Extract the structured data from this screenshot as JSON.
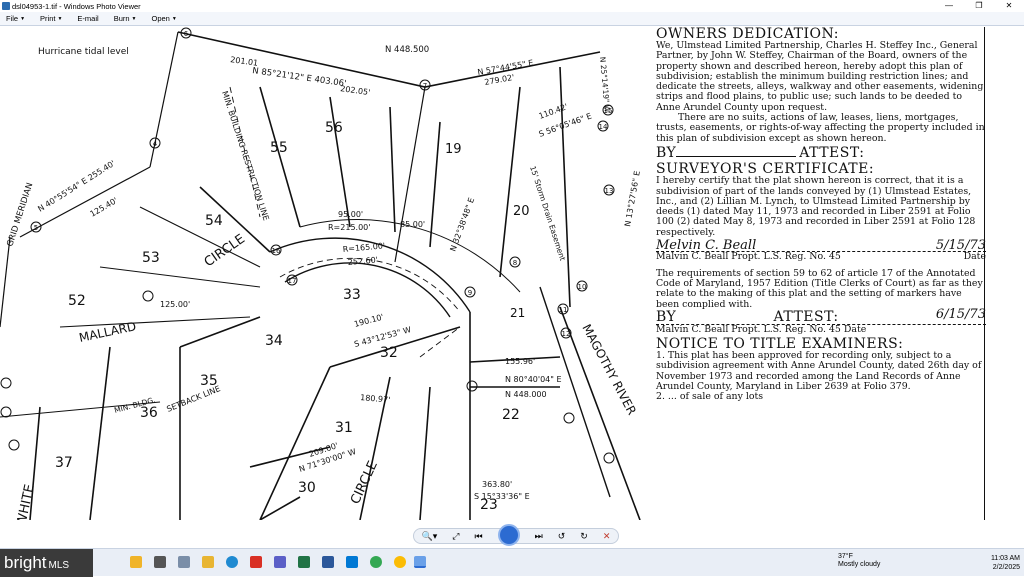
{
  "window": {
    "title": "dsl04953-1.tif - Windows Photo Viewer",
    "buttons": [
      "—",
      "❐",
      "✕"
    ]
  },
  "menu": {
    "items": [
      {
        "label": "File"
      },
      {
        "label": "Print"
      },
      {
        "label": "E-mail"
      },
      {
        "label": "Burn"
      },
      {
        "label": "Open"
      }
    ]
  },
  "plat": {
    "lots": [
      "56",
      "55",
      "54",
      "53",
      "52",
      "33",
      "34",
      "35",
      "36",
      "37",
      "32",
      "31",
      "30",
      "21",
      "22",
      "23",
      "20",
      "19"
    ],
    "streets": [
      "CIRCLE",
      "MALLARD",
      "CIRCLE",
      "WHITE",
      "MAGOTHY RIVER"
    ],
    "labels": {
      "hurricane": "Hurricane tidal level",
      "grid": "GRID MERIDIAN",
      "bldg_line": "MIN. BUILDING RESTRICTION LINE",
      "setback": "SETBACK LINE",
      "storm": "15' Storm Drain Easement",
      "minbldg": "MIN. BLDG."
    },
    "bearings": [
      "N 85°21'12\" E 403.06'",
      "N 448.500",
      "N 57°44'55\" E",
      "279.02'",
      "202.05'",
      "201.01",
      "R=165.00'",
      "252.60'",
      "R=215.00'",
      "95.00'",
      "85.00'",
      "N 40°55'54\" E 255.40'",
      "125.40'",
      "125.00'",
      "N 448.000",
      "N 71°30'00\" W",
      "209.00'",
      "S 43°12'53\" W",
      "190.10'",
      "180.97'",
      "155.96'",
      "N 80°40'04\" E",
      "N 32°38'48\" E",
      "110.42'",
      "S 56°05'46\" E",
      "N 13°27'56\" E",
      "N 25°14'19\" W",
      "363.80'",
      "S 15°33'36\" E"
    ],
    "circled": [
      "7",
      "8",
      "9",
      "10",
      "11",
      "12",
      "13",
      "14",
      "15",
      "16",
      "17",
      "4",
      "5",
      "6",
      "55",
      "56",
      "57",
      "58",
      "59",
      "60",
      "61",
      "54",
      "53",
      "52",
      "51",
      "1"
    ]
  },
  "certificate": {
    "heading1": "OWNERS DEDICATION:",
    "para1": "We, Ulmstead Limited Partnership, Charles H. Steffey Inc., General Partner, by John W. Steffey, Chairman of the Board, owners of the property shown and described hereon, hereby adopt this plan of subdivision; establish the minimum building restriction lines; and dedicate the streets, alleys, walkway and other easements, widening strips and flood plains, to public use; such lands to be deeded to Anne Arundel County upon request.",
    "para2": "There are no suits, actions of law, leases, liens, mortgages, trusts, easements, or rights-of-way affecting the property included in this plan of subdivision except as shown hereon.",
    "by1": "BY",
    "attest1": "ATTEST:",
    "heading2": "SURVEYOR'S CERTIFICATE:",
    "para3": "I hereby certify that the plat shown hereon is correct, that it is a subdivision of part of the lands conveyed by (1) Ulmstead Estates, Inc., and (2) Lillian M. Lynch, to Ulmstead Limited Partnership by deeds (1) dated May 11, 1973 and recorded in Liber 2591 at Folio 100 (2) dated May 8, 1973 and recorded in Liber 2591 at Folio 128 respectively.",
    "sig_surveyor": "Melvin C. Beall",
    "sig_date": "5/15/73",
    "surveyor_line": "Malvin C. Beall     Propt. L.S. Reg. No. 45",
    "date_label": "Date",
    "para4": "The requirements of section 59 to 62 of article 17 of the Annotated Code of Maryland, 1957 Edition (Title Clerks of Court) as far as they relate to the making of this plat and the setting of markers have been complied with.",
    "by2": "BY",
    "attest2": "ATTEST:",
    "sig_date2": "6/15/73",
    "surveyor_line2": "Malvin C. Beall     Propt. L.S. Reg. No. 45     Date",
    "heading3": "NOTICE TO TITLE EXAMINERS:",
    "para5": "1. This plat has been approved for recording only, subject to a subdivision agreement with Anne Arundel County, dated 26th day of November 1973 and recorded among the Land Records of Anne Arundel County, Maryland in Liber 2639 at Folio 379.",
    "para6": "2. ... of sale of any lots"
  },
  "controls": {
    "buttons": [
      "zoom",
      "fit",
      "previous",
      "slideshow",
      "next",
      "rotate-left",
      "rotate-right",
      "delete"
    ]
  },
  "taskbar": {
    "brand": "bright",
    "brand_suffix": "MLS",
    "weather_temp": "37°F",
    "weather_desc": "Mostly cloudy",
    "time": "11:03 AM",
    "date": "2/2/2025",
    "colors": {
      "accent": "#2c6bd1",
      "brand_bg": "#3a3a3a"
    }
  }
}
